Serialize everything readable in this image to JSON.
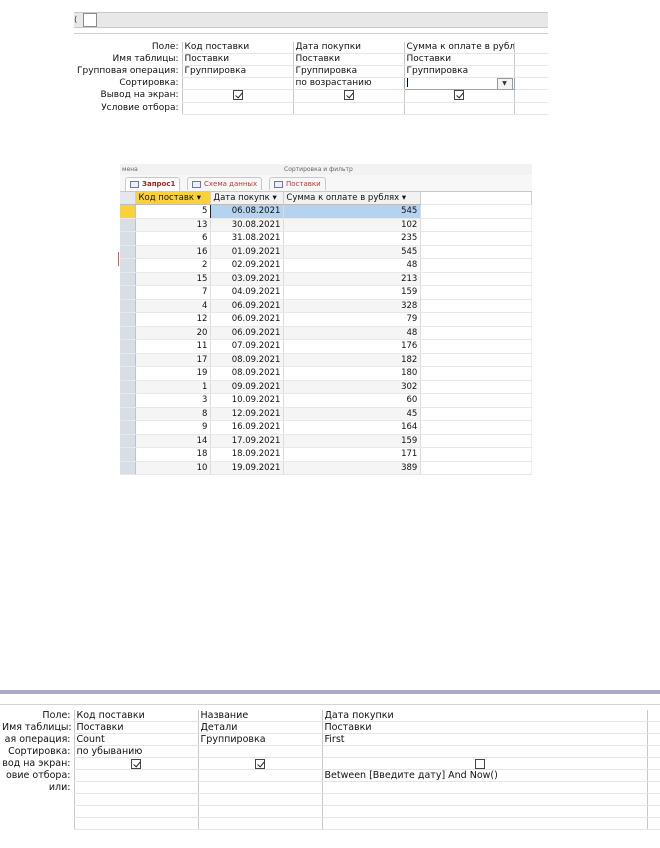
{
  "top_design": {
    "labels": [
      "Поле:",
      "Имя таблицы:",
      "Групповая операция:",
      "Сортировка:",
      "Вывод на экран:",
      "Условие отбора:"
    ],
    "columns": [
      {
        "field": "Код поставки",
        "table": "Поставки",
        "group": "Группировка",
        "sort": "",
        "show": true,
        "criteria": ""
      },
      {
        "field": "Дата покупки",
        "table": "Поставки",
        "group": "Группировка",
        "sort": "по возрастанию",
        "show": true,
        "criteria": ""
      },
      {
        "field": "Сумма к оплате в рубл",
        "table": "Поставки",
        "group": "Группировка",
        "sort": "",
        "show": true,
        "criteria": ""
      }
    ]
  },
  "datasheet": {
    "ribbon_fragment_left": "мена",
    "ribbon_fragment_mid": "Сортировка и фильтр",
    "tabs": [
      "Запрос1",
      "Схема данных",
      "Поставки"
    ],
    "headers": [
      "Код поставк ▾",
      "Дата покупк ▾",
      "Сумма к оплате в рублях ▾"
    ],
    "rows": [
      [
        "5",
        "06.08.2021",
        "545"
      ],
      [
        "13",
        "30.08.2021",
        "102"
      ],
      [
        "6",
        "31.08.2021",
        "235"
      ],
      [
        "16",
        "01.09.2021",
        "545"
      ],
      [
        "2",
        "02.09.2021",
        "48"
      ],
      [
        "15",
        "03.09.2021",
        "213"
      ],
      [
        "7",
        "04.09.2021",
        "159"
      ],
      [
        "4",
        "06.09.2021",
        "328"
      ],
      [
        "12",
        "06.09.2021",
        "79"
      ],
      [
        "20",
        "06.09.2021",
        "48"
      ],
      [
        "11",
        "07.09.2021",
        "176"
      ],
      [
        "17",
        "08.09.2021",
        "182"
      ],
      [
        "19",
        "08.09.2021",
        "180"
      ],
      [
        "1",
        "09.09.2021",
        "302"
      ],
      [
        "3",
        "10.09.2021",
        "60"
      ],
      [
        "8",
        "12.09.2021",
        "45"
      ],
      [
        "9",
        "16.09.2021",
        "164"
      ],
      [
        "14",
        "17.09.2021",
        "159"
      ],
      [
        "18",
        "18.09.2021",
        "171"
      ],
      [
        "10",
        "19.09.2021",
        "389"
      ]
    ]
  },
  "bottom_design": {
    "labels": [
      "Поле:",
      "Имя таблицы:",
      "ая операция:",
      "Сортировка:",
      "вод на экран:",
      "овие отбора:",
      "или:"
    ],
    "columns": [
      {
        "field": "Код поставки",
        "table": "Поставки",
        "group": "Count",
        "sort": "по убыванию",
        "show": true,
        "criteria": ""
      },
      {
        "field": "Название",
        "table": "Детали",
        "group": "Группировка",
        "sort": "",
        "show": true,
        "criteria": ""
      },
      {
        "field": "Дата покупки",
        "table": "Поставки",
        "group": "First",
        "sort": "",
        "show": false,
        "criteria": "Between [Введите дату] And Now()"
      }
    ]
  }
}
